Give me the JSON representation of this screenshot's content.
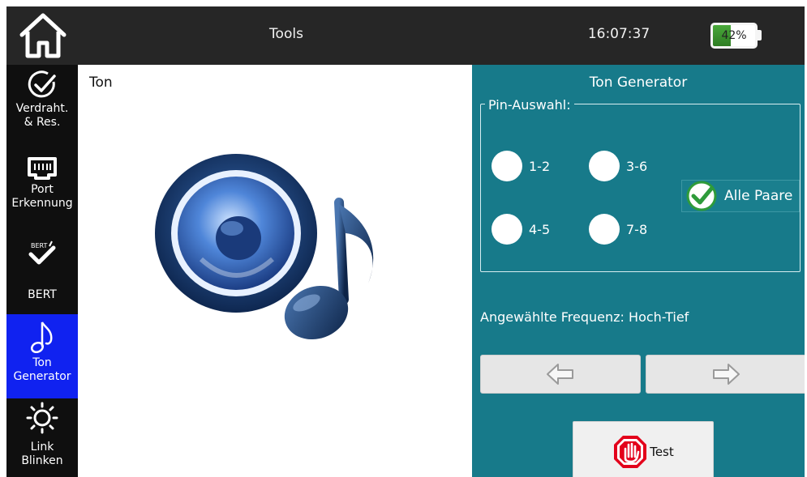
{
  "header": {
    "title": "Tools",
    "time": "16:07:37",
    "battery": {
      "percent_label": "42%",
      "level": 0.42
    }
  },
  "sidebar": {
    "items": [
      {
        "label": "Verdraht.\n& Res.",
        "icon": "checkmark-circle-icon",
        "active": false
      },
      {
        "label": "Port\nErkennung",
        "icon": "ethernet-port-icon",
        "active": false
      },
      {
        "label": "BERT",
        "icon": "bert-check-icon",
        "badge": "BERT",
        "active": false
      },
      {
        "label": "Ton\nGenerator",
        "icon": "music-note-icon",
        "active": true
      },
      {
        "label": "Link\nBlinken",
        "icon": "sun-blink-icon",
        "active": false
      }
    ]
  },
  "main": {
    "title": "Ton"
  },
  "panel": {
    "title": "Ton Generator",
    "group_label": "Pin-Auswahl:",
    "pins": [
      "1-2",
      "3-6",
      "4-5",
      "7-8"
    ],
    "all_pairs_label": "Alle Paare",
    "frequency_text": "Angewählte Frequenz: Hoch-Tief",
    "test_label": "Test"
  },
  "colors": {
    "active_nav": "#1022f0",
    "panel_bg": "#177a8a",
    "battery_green": "#3c9a2e",
    "stop_red": "#e3001b"
  }
}
